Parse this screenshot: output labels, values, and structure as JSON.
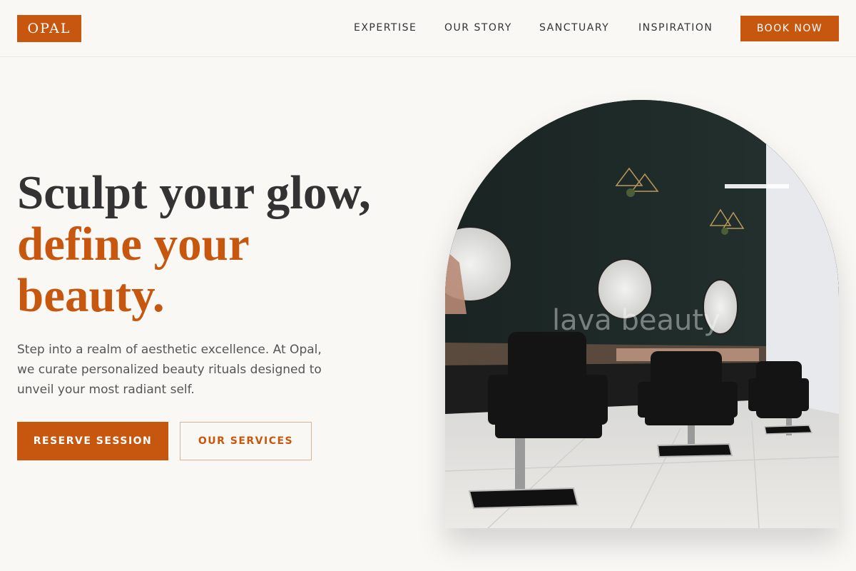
{
  "header": {
    "logo": "OPAL",
    "nav": [
      "EXPERTISE",
      "OUR STORY",
      "SANCTUARY",
      "INSPIRATION"
    ],
    "cta": "BOOK NOW"
  },
  "hero": {
    "headline_line1": "Sculpt your glow,",
    "headline_line2": "define your",
    "headline_line3": "beauty.",
    "subtext": "Step into a realm of aesthetic excellence. At Opal, we curate personalized beauty rituals designed to unveil your most radiant self.",
    "primary_button": "RESERVE SESSION",
    "secondary_button": "OUR SERVICES",
    "image_watermark": "lava beauty"
  },
  "colors": {
    "accent": "#c7570e",
    "background": "#faf8f5",
    "text": "#333333"
  }
}
